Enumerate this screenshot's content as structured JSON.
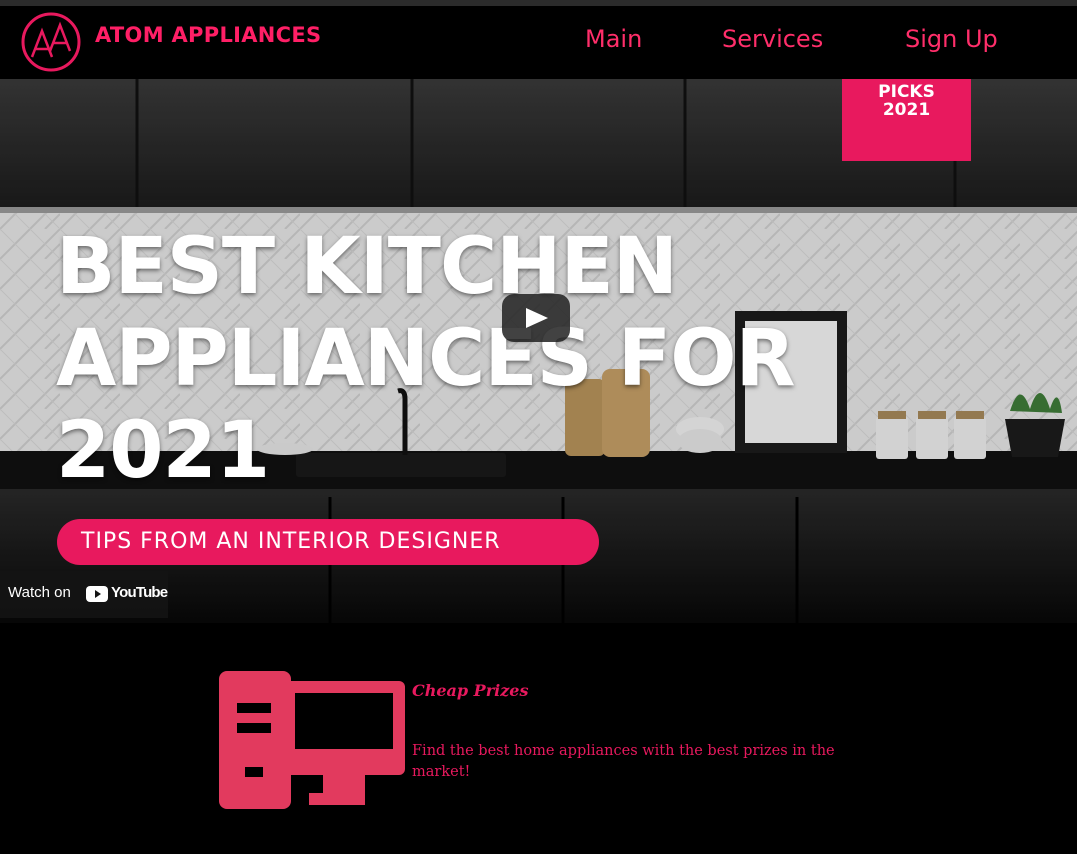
{
  "header": {
    "brand": "ATOM APPLIANCES",
    "logo_letters": "AA",
    "nav": [
      "Main",
      "Services",
      "Sign Up"
    ]
  },
  "video": {
    "headline": [
      "BEST KITCHEN",
      "APPLIANCES FOR",
      "2021"
    ],
    "picks_badge": [
      "PICKS",
      "2021"
    ],
    "subtitle_pill": "TIPS FROM AN INTERIOR DESIGNER",
    "watch_on": "Watch on",
    "youtube": "YouTube"
  },
  "feature": {
    "title": "Cheap Prizes",
    "text": "Find the best home appliances with the best prizes in the market!"
  },
  "colors": {
    "accent": "#e8195e",
    "brand": "#ff1f66",
    "nav": "#ff2e6a",
    "icon": "#e23a5e"
  },
  "icons": [
    "logo-icon",
    "play-icon",
    "youtube-icon",
    "computer-icon"
  ]
}
